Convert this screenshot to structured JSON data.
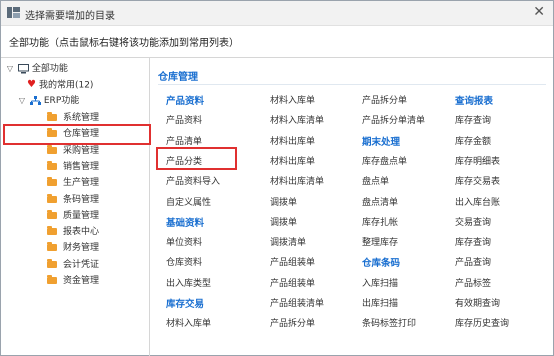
{
  "window": {
    "title": "选择需要增加的目录",
    "close_label": "✕"
  },
  "hint": "全部功能（点击鼠标右键将该功能添加到常用列表）",
  "tree": {
    "root": "全部功能",
    "favorites": "我的常用(12)",
    "erp": "ERP功能",
    "modules": [
      "系统管理",
      "仓库管理",
      "采购管理",
      "销售管理",
      "生产管理",
      "条码管理",
      "质量管理",
      "报表中心",
      "财务管理",
      "会计凭证",
      "资金管理"
    ],
    "selected": "仓库管理"
  },
  "section": {
    "title": "仓库管理",
    "columns": [
      [
        {
          "type": "group",
          "label": "产品资料"
        },
        {
          "type": "item",
          "label": "产品资料"
        },
        {
          "type": "item",
          "label": "产品清单"
        },
        {
          "type": "item",
          "label": "产品分类"
        },
        {
          "type": "item",
          "label": "产品资料导入"
        },
        {
          "type": "item",
          "label": "自定义属性"
        },
        {
          "type": "group",
          "label": "基础资料"
        },
        {
          "type": "item",
          "label": "单位资料"
        },
        {
          "type": "item",
          "label": "仓库资料"
        },
        {
          "type": "item",
          "label": "出入库类型"
        },
        {
          "type": "group",
          "label": "库存交易"
        },
        {
          "type": "item",
          "label": "材料入库单"
        }
      ],
      [
        {
          "type": "item",
          "label": "材料入库单"
        },
        {
          "type": "item",
          "label": "材料入库清单"
        },
        {
          "type": "item",
          "label": "材料出库单"
        },
        {
          "type": "item",
          "label": "材料出库单"
        },
        {
          "type": "item",
          "label": "材料出库清单"
        },
        {
          "type": "item",
          "label": "调拨单"
        },
        {
          "type": "item",
          "label": "调拨单"
        },
        {
          "type": "item",
          "label": "调拨清单"
        },
        {
          "type": "item",
          "label": "产品组装单"
        },
        {
          "type": "item",
          "label": "产品组装单"
        },
        {
          "type": "item",
          "label": "产品组装清单"
        },
        {
          "type": "item",
          "label": "产品拆分单"
        }
      ],
      [
        {
          "type": "item",
          "label": "产品拆分单"
        },
        {
          "type": "item",
          "label": "产品拆分单清单"
        },
        {
          "type": "group",
          "label": "期末处理"
        },
        {
          "type": "item",
          "label": "库存盘点单"
        },
        {
          "type": "item",
          "label": "盘点单"
        },
        {
          "type": "item",
          "label": "盘点清单"
        },
        {
          "type": "item",
          "label": "库存扎帐"
        },
        {
          "type": "item",
          "label": "整理库存"
        },
        {
          "type": "group",
          "label": "仓库条码"
        },
        {
          "type": "item",
          "label": "入库扫描"
        },
        {
          "type": "item",
          "label": "出库扫描"
        },
        {
          "type": "item",
          "label": "条码标签打印"
        }
      ],
      [
        {
          "type": "group",
          "label": "查询报表"
        },
        {
          "type": "item",
          "label": "库存查询"
        },
        {
          "type": "item",
          "label": "库存金额"
        },
        {
          "type": "item",
          "label": "库存明细表"
        },
        {
          "type": "item",
          "label": "库存交易表"
        },
        {
          "type": "item",
          "label": "出入库台账"
        },
        {
          "type": "item",
          "label": "交易查询"
        },
        {
          "type": "item",
          "label": "库存查询"
        },
        {
          "type": "item",
          "label": "产品查询"
        },
        {
          "type": "item",
          "label": "产品标签"
        },
        {
          "type": "item",
          "label": "有效期查询"
        },
        {
          "type": "item",
          "label": "库存历史查询"
        }
      ]
    ],
    "highlighted": "产品分类"
  },
  "colors": {
    "accent": "#1a6fd0",
    "highlight": "#e03030",
    "folder": "#f0a030",
    "heart": "#e02020"
  }
}
